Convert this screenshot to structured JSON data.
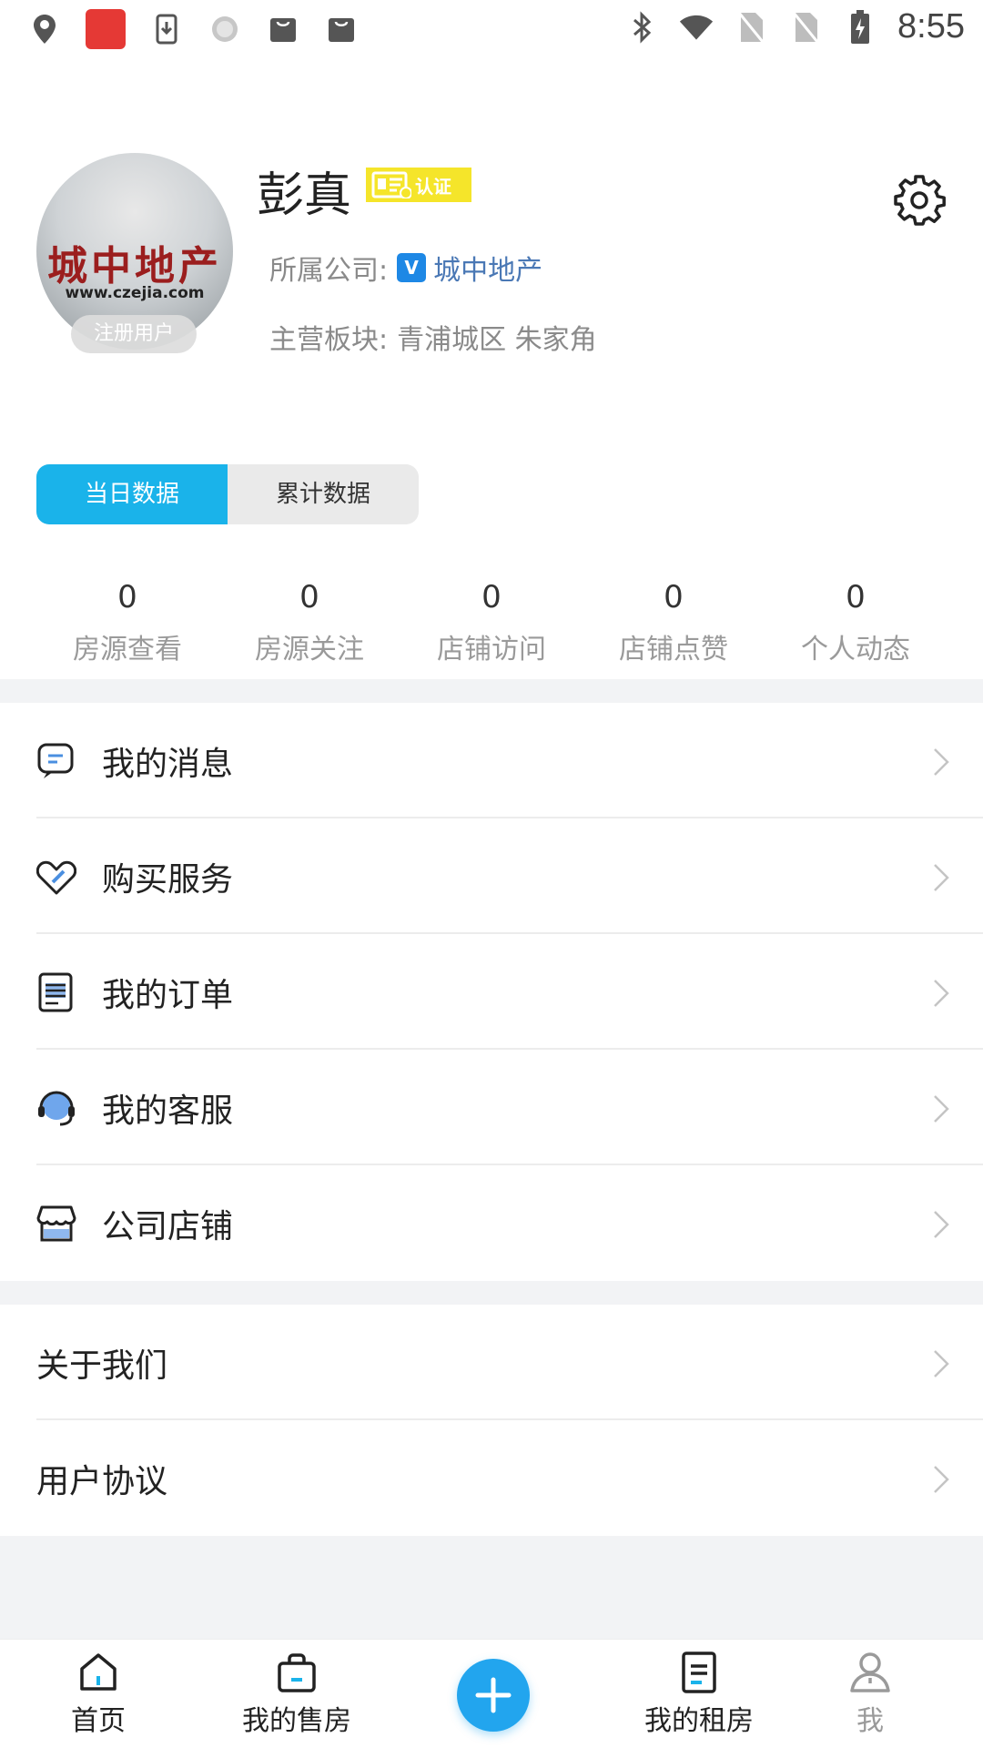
{
  "status_bar": {
    "time": "8:55",
    "left_icons": [
      "location-icon",
      "app-notification-icon",
      "download-icon",
      "sync-icon",
      "bag-icon",
      "bag-icon"
    ],
    "right_icons": [
      "bluetooth-icon",
      "wifi-icon",
      "no-sim-icon",
      "no-sim-icon",
      "battery-charging-icon"
    ]
  },
  "profile": {
    "name": "彭真",
    "auth_badge": "认证",
    "avatar_text": "城中地产",
    "avatar_url_text": "www.czejia.com",
    "avatar_badge": "注册用户",
    "company_label": "所属公司:",
    "company_icon_text": "V",
    "company_name": "城中地产",
    "area_label": "主营板块:",
    "area_value": "青浦城区 朱家角"
  },
  "tabs": [
    {
      "label": "当日数据",
      "active": true
    },
    {
      "label": "累计数据",
      "active": false
    }
  ],
  "stats": [
    {
      "value": "0",
      "label": "房源查看"
    },
    {
      "value": "0",
      "label": "房源关注"
    },
    {
      "value": "0",
      "label": "店铺访问"
    },
    {
      "value": "0",
      "label": "店铺点赞"
    },
    {
      "value": "0",
      "label": "个人动态"
    }
  ],
  "menu": [
    {
      "label": "我的消息",
      "icon": "message-icon"
    },
    {
      "label": "购买服务",
      "icon": "tag-icon"
    },
    {
      "label": "我的订单",
      "icon": "order-icon"
    },
    {
      "label": "我的客服",
      "icon": "headset-icon"
    },
    {
      "label": "公司店铺",
      "icon": "store-icon"
    }
  ],
  "menu2": [
    {
      "label": "关于我们"
    },
    {
      "label": "用户协议"
    }
  ],
  "bottom_nav": [
    {
      "label": "首页",
      "icon": "home-icon"
    },
    {
      "label": "我的售房",
      "icon": "shopping-bag-icon"
    },
    {
      "label": "",
      "icon": "plus-icon"
    },
    {
      "label": "我的租房",
      "icon": "document-icon"
    },
    {
      "label": "我",
      "icon": "person-icon"
    }
  ],
  "colors": {
    "accent": "#1ab3ea",
    "fab": "#22a5ee",
    "auth_badge": "#f5e52a",
    "separator": "#f2f3f5"
  }
}
